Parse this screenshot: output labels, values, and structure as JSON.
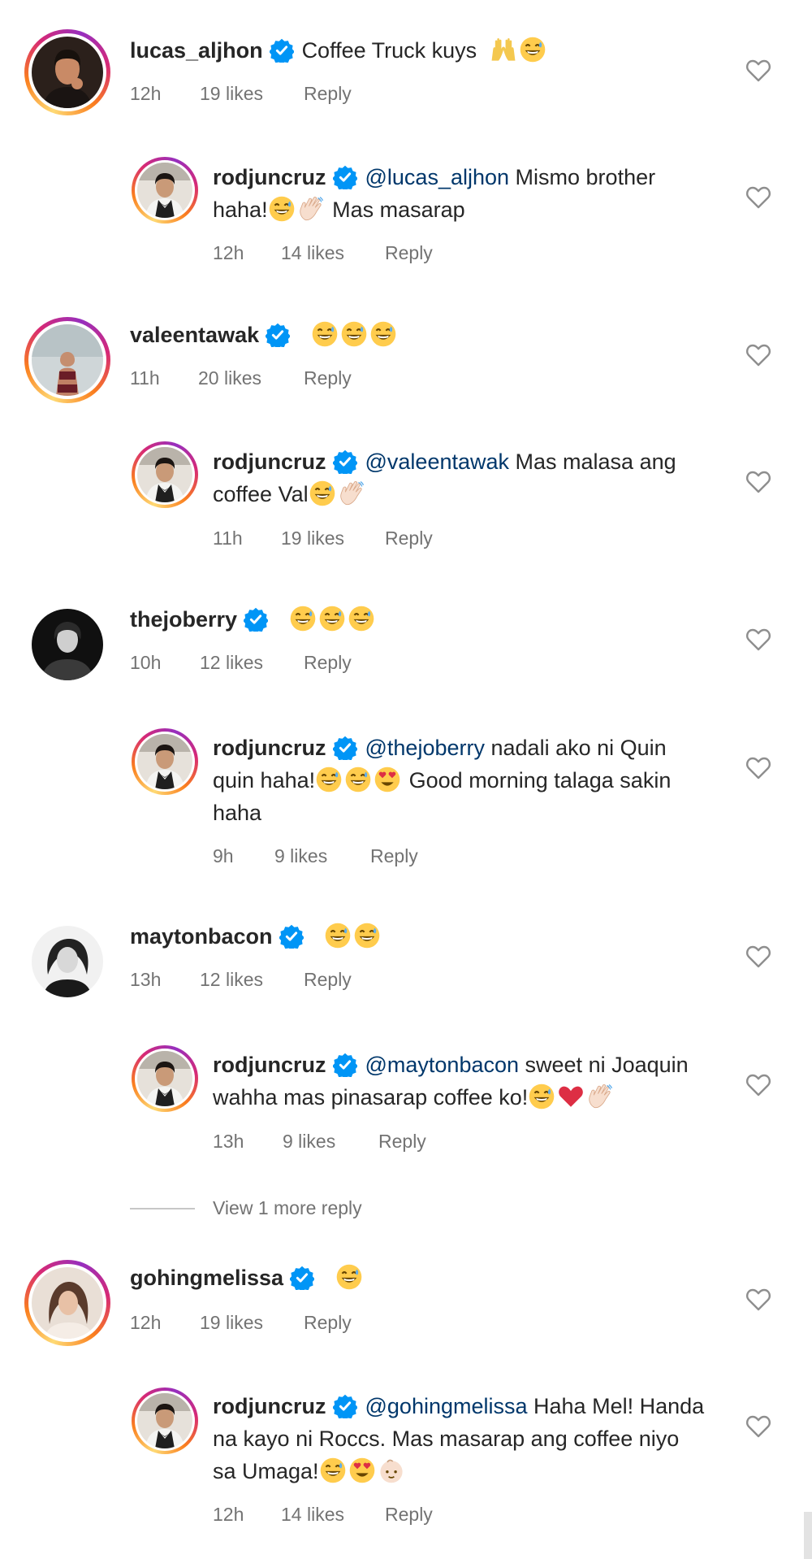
{
  "comments": [
    {
      "username": "lucas_aljhon",
      "text": "Coffee Truck kuys",
      "emojis": [
        "raised-hands-emoji",
        "grinning-sweat-emoji"
      ],
      "time": "12h",
      "likes": "19 likes",
      "reply": "Reply",
      "avatar_colors": [
        "#3a2a22",
        "#c98a66"
      ]
    },
    {
      "username": "rodjuncruz",
      "mention": "@lucas_aljhon",
      "text_line1": "Mismo brother",
      "text_line2_before": "haha!",
      "emojis_mid": [
        "grinning-sweat-emoji",
        "waving-hand-emoji"
      ],
      "text_line2_after": "Mas masarap",
      "time": "12h",
      "likes": "14 likes",
      "reply": "Reply"
    },
    {
      "username": "valeentawak",
      "emojis": [
        "grinning-sweat-emoji",
        "grinning-sweat-emoji",
        "grinning-sweat-emoji"
      ],
      "time": "11h",
      "likes": "20 likes",
      "reply": "Reply"
    },
    {
      "username": "rodjuncruz",
      "mention": "@valeentawak",
      "text_line1": "Mas malasa ang",
      "text_line2_before": "coffee Val",
      "emojis_mid": [
        "grinning-sweat-emoji",
        "waving-hand-emoji"
      ],
      "time": "11h",
      "likes": "19 likes",
      "reply": "Reply"
    },
    {
      "username": "thejoberry",
      "emojis": [
        "grinning-sweat-emoji",
        "grinning-sweat-emoji",
        "grinning-sweat-emoji"
      ],
      "time": "10h",
      "likes": "12 likes",
      "reply": "Reply"
    },
    {
      "username": "rodjuncruz",
      "mention": "@thejoberry",
      "text_line1": "nadali ako ni Quin",
      "text_line2_before": "quin haha!",
      "emojis_mid": [
        "grinning-sweat-emoji",
        "grinning-sweat-emoji",
        "heart-eyes-emoji"
      ],
      "text_line2_after": "Good morning talaga sakin",
      "text_line3": "haha",
      "time": "9h",
      "likes": "9 likes",
      "reply": "Reply"
    },
    {
      "username": "maytonbacon",
      "emojis": [
        "grinning-sweat-emoji",
        "grinning-sweat-emoji"
      ],
      "time": "13h",
      "likes": "12 likes",
      "reply": "Reply"
    },
    {
      "username": "rodjuncruz",
      "mention": "@maytonbacon",
      "text_line1": "sweet ni Joaquin",
      "text_line2_before": "wahha mas pinasarap coffee ko!",
      "emojis_mid": [
        "grinning-sweat-emoji",
        "red-heart-emoji",
        "waving-hand-emoji"
      ],
      "time": "13h",
      "likes": "9 likes",
      "reply": "Reply"
    },
    {
      "username": "gohingmelissa",
      "emojis": [
        "grinning-sweat-emoji"
      ],
      "time": "12h",
      "likes": "19 likes",
      "reply": "Reply"
    },
    {
      "username": "rodjuncruz",
      "mention": "@gohingmelissa",
      "text_line1": "Haha Mel! Handa",
      "text_line2_before": "na kayo ni Roccs. Mas masarap ang coffee niyo",
      "text_line3": "sa Umaga!",
      "emojis_end": [
        "grinning-sweat-emoji",
        "heart-eyes-emoji",
        "baby-emoji"
      ],
      "time": "12h",
      "likes": "14 likes",
      "reply": "Reply"
    }
  ],
  "view_more_reply": "View 1 more reply",
  "colors": {
    "verified": "#0095f6",
    "mention": "#00376b",
    "meta": "#737373"
  }
}
